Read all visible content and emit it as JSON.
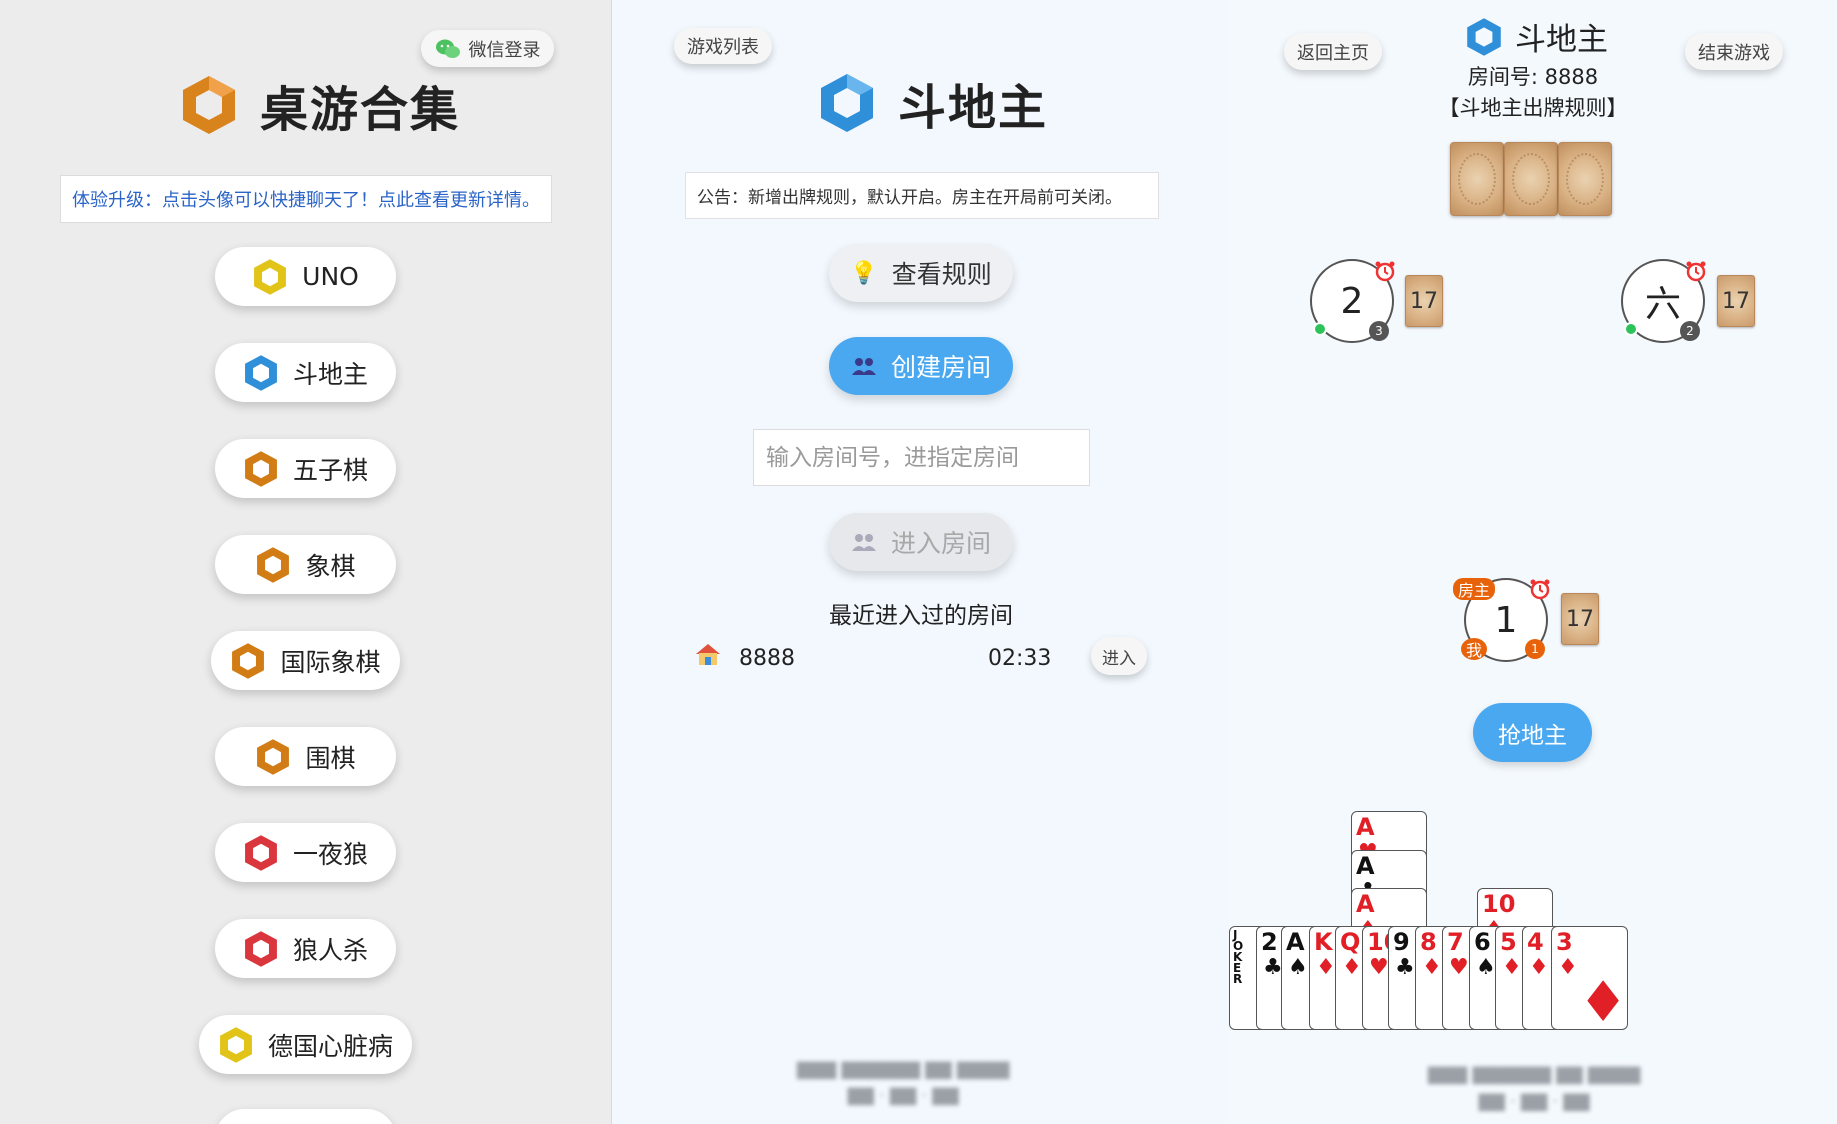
{
  "left": {
    "wechat_login": "微信登录",
    "title": "桌游合集",
    "notice": "体验升级：点击头像可以快捷聊天了！点此查看更新详情。",
    "games": [
      "UNO",
      "斗地主",
      "五子棋",
      "象棋",
      "国际象棋",
      "围棋",
      "一夜狼",
      "狼人杀",
      "德国心脏病"
    ]
  },
  "middle": {
    "game_list": "游戏列表",
    "title": "斗地主",
    "notice": "公告：新增出牌规则，默认开启。房主在开局前可关闭。",
    "rules_button": "查看规则",
    "create_button": "创建房间",
    "room_input_placeholder": "输入房间号，进指定房间",
    "enter_button": "进入房间",
    "recent_title": "最近进入过的房间",
    "recent": [
      {
        "room": "8888",
        "time": "02:33",
        "action": "进入"
      }
    ]
  },
  "right": {
    "back_home": "返回主页",
    "end_game": "结束游戏",
    "title": "斗地主",
    "room_no": "房间号: 8888",
    "rule_label": "【斗地主出牌规则】",
    "players": [
      {
        "name": "2",
        "badge": "3",
        "count": "17"
      },
      {
        "name": "六",
        "badge": "2",
        "count": "17"
      },
      {
        "name": "1",
        "badge": "1",
        "count": "17",
        "host_tag": "房主",
        "me_tag": "我"
      }
    ],
    "grab_button": "抢地主",
    "hand": [
      {
        "rank": "JOKER",
        "suit": "",
        "color": "black"
      },
      {
        "rank": "2",
        "suit": "♣",
        "color": "black"
      },
      {
        "rank": "A",
        "suit": "♠",
        "color": "black"
      },
      {
        "rank": "K",
        "suit": "♦",
        "color": "red"
      },
      {
        "rank": "Q",
        "suit": "♦",
        "color": "red"
      },
      {
        "rank": "10",
        "suit": "♥",
        "color": "red"
      },
      {
        "rank": "9",
        "suit": "♣",
        "color": "black"
      },
      {
        "rank": "8",
        "suit": "♦",
        "color": "red"
      },
      {
        "rank": "7",
        "suit": "♥",
        "color": "red"
      },
      {
        "rank": "6",
        "suit": "♠",
        "color": "black"
      },
      {
        "rank": "5",
        "suit": "♦",
        "color": "red"
      },
      {
        "rank": "4",
        "suit": "♦",
        "color": "red"
      },
      {
        "rank": "3",
        "suit": "♦",
        "color": "red"
      }
    ],
    "stacked_a": [
      {
        "rank": "A",
        "suit": "♥",
        "color": "red"
      },
      {
        "rank": "A",
        "suit": "♣",
        "color": "black"
      },
      {
        "rank": "A",
        "suit": "♦",
        "color": "red"
      }
    ],
    "stacked_10": {
      "rank": "10",
      "suit": "♦",
      "color": "red"
    }
  },
  "colors": {
    "accent_blue": "#4aa8f0",
    "host_orange": "#e8620a",
    "notice_blue": "#2a64c8"
  }
}
